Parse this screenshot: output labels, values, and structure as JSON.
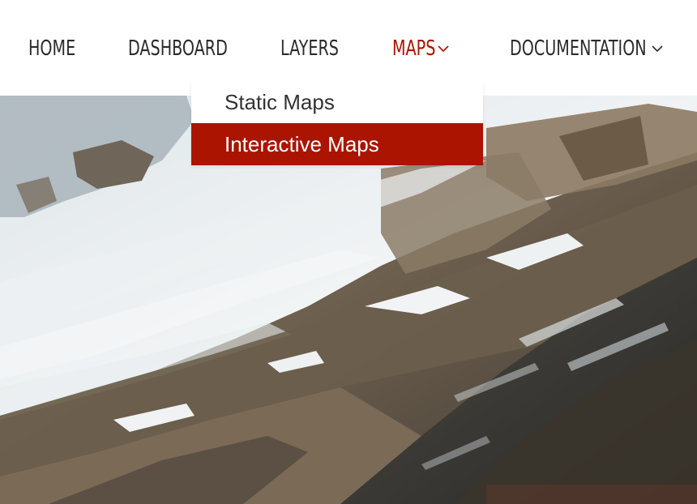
{
  "nav": {
    "items": [
      {
        "label": "HOME",
        "has_dropdown": false,
        "active": false
      },
      {
        "label": "DASHBOARD",
        "has_dropdown": false,
        "active": false
      },
      {
        "label": "LAYERS",
        "has_dropdown": false,
        "active": false
      },
      {
        "label": "MAPS",
        "has_dropdown": true,
        "active": true
      },
      {
        "label": "DOCUMENTATION",
        "has_dropdown": true,
        "active": false
      }
    ]
  },
  "maps_dropdown": {
    "items": [
      {
        "label": "Static Maps",
        "highlighted": false
      },
      {
        "label": "Interactive Maps",
        "highlighted": true
      }
    ]
  },
  "colors": {
    "accent": "#ab1400",
    "nav_text": "#2b2b2b",
    "dropdown_text": "#333333",
    "background": "#ffffff"
  },
  "icons": {
    "dropdown_indicator": "chevron-down-icon"
  }
}
